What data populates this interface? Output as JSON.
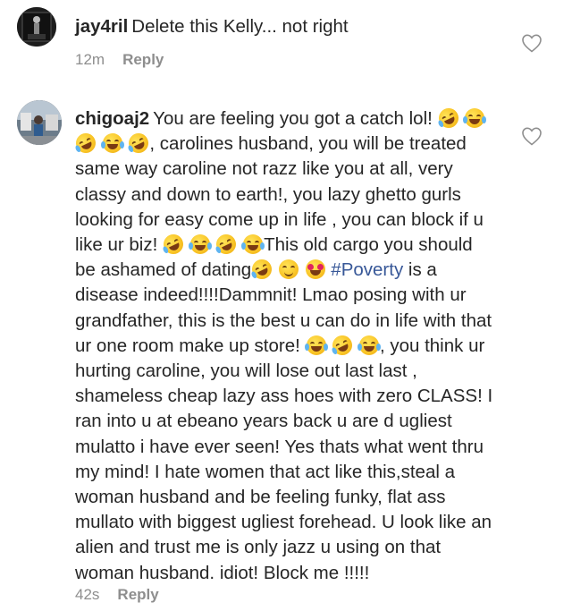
{
  "comments": [
    {
      "username": "jay4ril",
      "text": "Delete this Kelly... not right",
      "time": "12m",
      "reply_label": "Reply",
      "avatar_icon": "dark-photo-avatar",
      "like_icon": "heart-outline-icon"
    },
    {
      "username": "chigoaj2",
      "text_1": "You are feeling you got a catch lol!",
      "text_2": ", carolines husband, you will be treated same way caroline not razz like you at all, very classy and down to earth!, you lazy ghetto  gurls looking for easy come up in life , you can block if u like ur biz!",
      "text_3": "This old cargo you should be ashamed of dating",
      "hashtag": "#Poverty",
      "text_4": "is a disease indeed!!!!Dammnit! Lmao posing with ur grandfather, this is the best u can do in life with that ur one room make up store!",
      "text_5": ", you think ur hurting caroline, you will lose out last last , shameless cheap lazy ass hoes with zero CLASS! I ran into u at ebeano years back u are d ugliest mulatto i have ever seen! Yes thats what went thru my mind! I hate women that act like this,steal a woman husband and be feeling funky, flat ass mullato with biggest ugliest forehead. U look like an alien and trust me is only jazz u using on that woman husband. idiot! Block me !!!!!",
      "time": "42s",
      "reply_label": "Reply",
      "avatar_icon": "outdoor-photo-avatar",
      "like_icon": "heart-outline-icon",
      "emoji_names": [
        "rofl-emoji",
        "joy-emoji",
        "rofl-emoji",
        "joy-emoji",
        "rofl-emoji",
        "smiling-blush-emoji",
        "heart-eyes-emoji"
      ]
    }
  ],
  "colors": {
    "text": "#262626",
    "meta": "#8e8e8e",
    "hashtag": "#385898"
  }
}
